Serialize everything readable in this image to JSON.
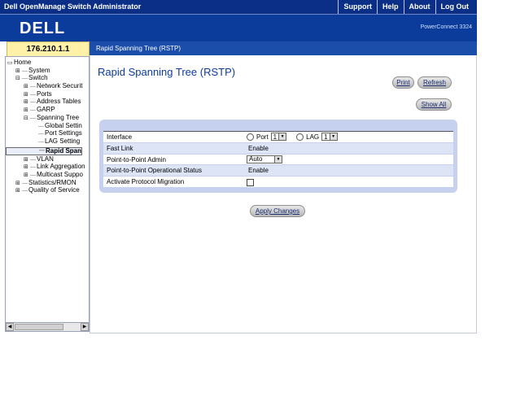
{
  "header": {
    "app_title": "Dell OpenManage Switch Administrator",
    "links": [
      "Support",
      "Help",
      "About",
      "Log Out"
    ],
    "model": "PowerConnect 3324",
    "ip": "176.210.1.1",
    "breadcrumb": "Rapid Spanning Tree (RSTP)"
  },
  "brand": {
    "logo_text": "DELL"
  },
  "tree": [
    {
      "label": "Home",
      "depth": 0,
      "exp": "",
      "icon": "home-icon"
    },
    {
      "label": "System",
      "depth": 1,
      "exp": "+"
    },
    {
      "label": "Switch",
      "depth": 1,
      "exp": "-"
    },
    {
      "label": "Network Securit",
      "depth": 2,
      "exp": "+"
    },
    {
      "label": "Ports",
      "depth": 2,
      "exp": "+"
    },
    {
      "label": "Address Tables",
      "depth": 2,
      "exp": "+"
    },
    {
      "label": "GARP",
      "depth": 2,
      "exp": "+"
    },
    {
      "label": "Spanning Tree",
      "depth": 2,
      "exp": "-"
    },
    {
      "label": "Global Settin",
      "depth": 3,
      "exp": ""
    },
    {
      "label": "Port Settings",
      "depth": 3,
      "exp": ""
    },
    {
      "label": "LAG Setting",
      "depth": 3,
      "exp": ""
    },
    {
      "label": "Rapid Span",
      "depth": 3,
      "exp": "",
      "selected": true
    },
    {
      "label": "VLAN",
      "depth": 2,
      "exp": "+"
    },
    {
      "label": "Link Aggregation",
      "depth": 2,
      "exp": "+"
    },
    {
      "label": "Multicast Suppo",
      "depth": 2,
      "exp": "+"
    },
    {
      "label": "Statistics/RMON",
      "depth": 1,
      "exp": "+"
    },
    {
      "label": "Quality of Service",
      "depth": 1,
      "exp": "+"
    }
  ],
  "main": {
    "title": "Rapid Spanning Tree (RSTP)",
    "buttons": {
      "print": "Print",
      "refresh": "Refresh",
      "show_all": "Show All",
      "apply": "Apply Changes"
    },
    "rows": [
      {
        "label": "Interface",
        "type": "interface",
        "port_label": "Port",
        "port_value": "1",
        "lag_label": "LAG",
        "lag_value": "1"
      },
      {
        "label": "Fast Link",
        "type": "text",
        "value": "Enable"
      },
      {
        "label": "Point-to-Point Admin",
        "type": "select",
        "value": "Auto"
      },
      {
        "label": "Point-to-Point Operational Status",
        "type": "text",
        "value": "Enable"
      },
      {
        "label": "Activate Protocol Migration",
        "type": "checkbox",
        "checked": false
      }
    ]
  }
}
